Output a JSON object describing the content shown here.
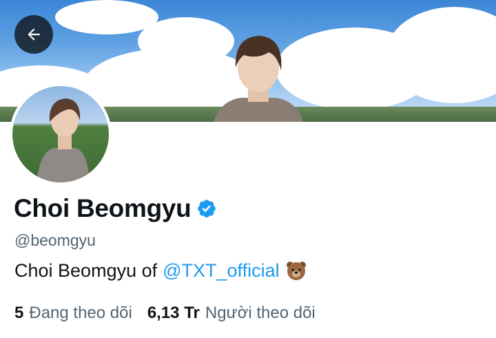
{
  "profile": {
    "display_name": "Choi Beomgyu",
    "handle": "@beomgyu",
    "bio_text": "Choi Beomgyu of",
    "bio_mention": "@TXT_official",
    "bio_emoji": "bear-face",
    "verified": true
  },
  "stats": {
    "following_count": "5",
    "following_label": "Đang theo dõi",
    "followers_count": "6,13 Tr",
    "followers_label": "Người theo dõi"
  },
  "colors": {
    "accent": "#1d9bf0",
    "text_primary": "#0f1419",
    "text_secondary": "#536471"
  },
  "icons": {
    "back": "arrow-left-icon",
    "verified": "verified-badge-icon",
    "emoji": "bear-icon"
  }
}
